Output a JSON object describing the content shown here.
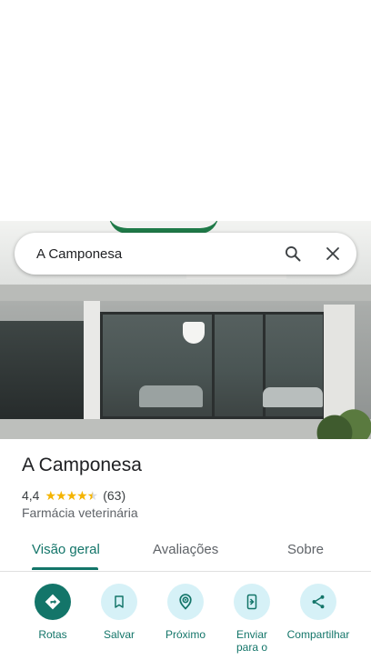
{
  "search": {
    "query": "A Camponesa",
    "search_icon": "search-icon",
    "close_icon": "close-icon"
  },
  "place": {
    "name": "A Camponesa",
    "rating": "4,4",
    "stars_value": 4.4,
    "reviews_count": "(63)",
    "category": "Farmácia veterinária"
  },
  "tabs": [
    {
      "label": "Visão geral",
      "active": true
    },
    {
      "label": "Avaliações",
      "active": false
    },
    {
      "label": "Sobre",
      "active": false
    }
  ],
  "actions": [
    {
      "label": "Rotas",
      "icon": "directions-icon"
    },
    {
      "label": "Salvar",
      "icon": "bookmark-icon"
    },
    {
      "label": "Próximo",
      "icon": "nearby-icon"
    },
    {
      "label": "Enviar para o",
      "icon": "send-to-phone-icon"
    },
    {
      "label": "Compartilhar",
      "icon": "share-icon"
    }
  ],
  "colors": {
    "accent": "#137569",
    "action_bg": "#d6f1f7",
    "star": "#f4b400"
  }
}
